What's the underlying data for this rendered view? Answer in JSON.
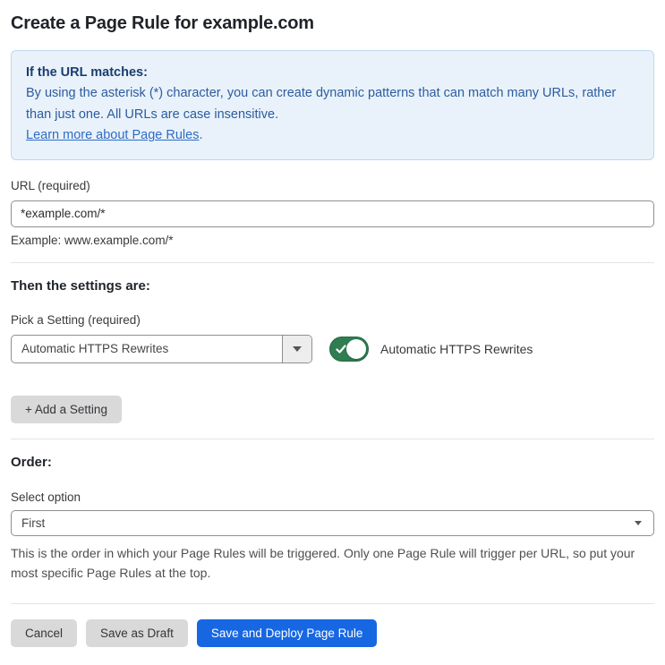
{
  "page": {
    "title": "Create a Page Rule for example.com"
  },
  "info_box": {
    "heading": "If the URL matches:",
    "body": "By using the asterisk (*) character, you can create dynamic patterns that can match many URLs, rather than just one. All URLs are case insensitive.",
    "link_label": "Learn more about Page Rules",
    "link_suffix": "."
  },
  "url_field": {
    "label": "URL (required)",
    "value": "*example.com/*",
    "helper": "Example: www.example.com/*"
  },
  "settings": {
    "heading": "Then the settings are:",
    "picker_label": "Pick a Setting (required)",
    "selected_setting": "Automatic HTTPS Rewrites",
    "toggle_label": "Automatic HTTPS Rewrites",
    "toggle_state": "on",
    "add_button_label": "+ Add a Setting"
  },
  "order": {
    "heading": "Order:",
    "select_label": "Select option",
    "selected_option": "First",
    "helper": "This is the order in which your Page Rules will be triggered. Only one Page Rule will trigger per URL, so put your most specific Page Rules at the top."
  },
  "footer": {
    "cancel_label": "Cancel",
    "save_draft_label": "Save as Draft",
    "deploy_label": "Save and Deploy Page Rule"
  },
  "colors": {
    "accent_blue": "#1767e2",
    "toggle_green": "#2f7d51",
    "info_background": "#e9f2fb",
    "info_border": "#bcd8f1",
    "info_heading_text": "#1b3d6e",
    "info_body_text": "#2c5c9e",
    "link_text": "#2d6cc4",
    "gray_button": "#d9d9d9"
  }
}
